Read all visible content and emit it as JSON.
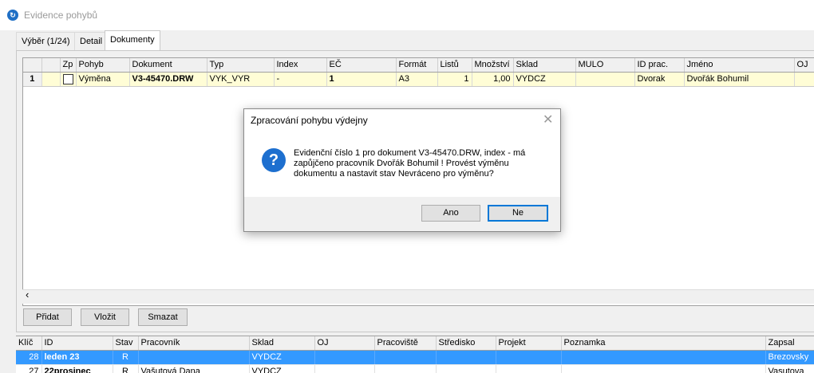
{
  "window": {
    "title": "Evidence pohybů",
    "icon": "app-logo-icon"
  },
  "tabs": [
    "Výběr (1/24)",
    "Detail",
    "Dokumenty"
  ],
  "active_tab": "Dokumenty",
  "documents_grid": {
    "columns": [
      "",
      "Zp",
      "Pohyb",
      "Dokument",
      "Typ",
      "Index",
      "EČ",
      "Formát",
      "Listů",
      "Množství",
      "Sklad",
      "MULO",
      "ID prac.",
      "Jméno",
      "OJ"
    ],
    "rows": [
      {
        "num": "1",
        "zp": "",
        "pohyb": "Výměna",
        "dokument": "V3-45470.DRW",
        "typ": "VYK_VYR",
        "index": "-",
        "ec": "1",
        "format": "A3",
        "listu": "1",
        "mnozstvi": "1,00",
        "sklad": "VYDCZ",
        "mulo": "",
        "id_prac": "Dvorak",
        "jmeno": "Dvořák Bohumil",
        "oj": ""
      }
    ],
    "scroll_left_icon": "scroll-left-arrow-icon",
    "row_highlight": "#fffdd6"
  },
  "buttons": {
    "add": "Přidat",
    "insert": "Vložit",
    "delete": "Smazat"
  },
  "movements_grid": {
    "columns": [
      "Klíč",
      "ID",
      "Stav",
      "Pracovník",
      "Sklad",
      "OJ",
      "Pracoviště",
      "Středisko",
      "Projekt",
      "Poznamka",
      "Zapsal"
    ],
    "rows": [
      {
        "klic": "28",
        "id": "leden 23",
        "stav": "R",
        "pracovnik": "",
        "sklad": "VYDCZ",
        "oj": "",
        "pracoviste": "",
        "stredisko": "",
        "projekt": "",
        "poznamka": "",
        "zapsal": "Brezovsky",
        "selected": true
      },
      {
        "klic": "27",
        "id": "22prosinec",
        "stav": "R",
        "pracovnik": "Vašutová Dana",
        "sklad": "VYDCZ",
        "oj": "",
        "pracoviste": "",
        "stredisko": "",
        "projekt": "",
        "poznamka": "",
        "zapsal": "Vasutova",
        "selected": false
      }
    ],
    "selection_color": "#3399ff"
  },
  "dialog": {
    "title": "Zpracování pohybu výdejny",
    "close_icon": "close-icon",
    "icon": "question-icon",
    "message": "Evidenční číslo 1 pro dokument V3-45470.DRW, index - má zapůjčeno pracovník Dvořák Bohumil ! Provést výměnu dokumentu a nastavit stav Nevráceno pro výměnu?",
    "yes": "Ano",
    "no": "Ne"
  }
}
